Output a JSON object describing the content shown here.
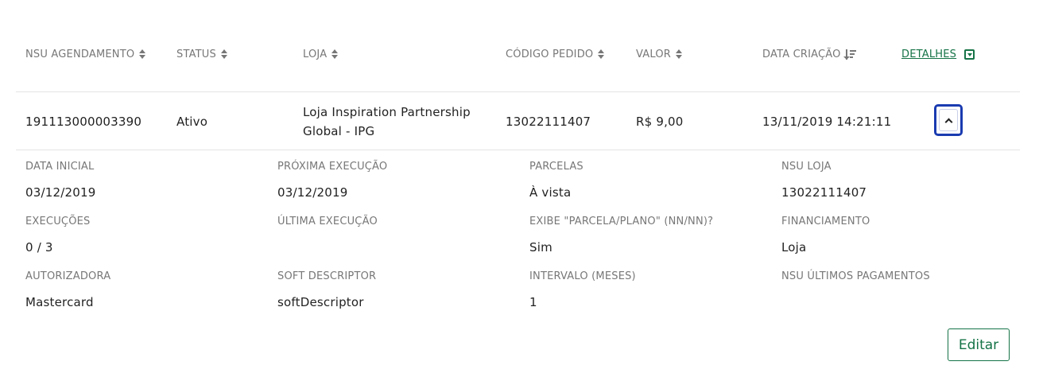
{
  "table": {
    "headers": [
      {
        "label": "NSU AGENDAMENTO"
      },
      {
        "label": "STATUS"
      },
      {
        "label": "LOJA"
      },
      {
        "label": "CÓDIGO PEDIDO"
      },
      {
        "label": "VALOR"
      },
      {
        "label": "DATA CRIAÇÃO"
      },
      {
        "label": "DETALHES"
      }
    ],
    "row": {
      "nsu": "191113000003390",
      "status": "Ativo",
      "loja_line1": "Loja Inspiration Partnership",
      "loja_line2": "Global - IPG",
      "codigo_pedido": "13022111407",
      "valor": "R$ 9,00",
      "data_criacao": "13/11/2019 14:21:11"
    }
  },
  "details": [
    {
      "label": "DATA INICIAL",
      "value": "03/12/2019"
    },
    {
      "label": "PRÓXIMA EXECUÇÃO",
      "value": "03/12/2019"
    },
    {
      "label": "PARCELAS",
      "value": "À vista"
    },
    {
      "label": "NSU LOJA",
      "value": "13022111407"
    },
    {
      "label": "EXECUÇÕES",
      "value": "0 / 3"
    },
    {
      "label": "ÚLTIMA EXECUÇÃO",
      "value": ""
    },
    {
      "label": "EXIBE \"PARCELA/PLANO\" (NN/NN)?",
      "value": "Sim"
    },
    {
      "label": "FINANCIAMENTO",
      "value": "Loja"
    },
    {
      "label": "AUTORIZADORA",
      "value": "Mastercard"
    },
    {
      "label": "SOFT DESCRIPTOR",
      "value": "softDescriptor"
    },
    {
      "label": "INTERVALO (MESES)",
      "value": "1"
    },
    {
      "label": "NSU ÚLTIMOS PAGAMENTOS",
      "value": ""
    }
  ],
  "actions": {
    "edit_label": "Editar"
  },
  "colors": {
    "accent": "#157347",
    "focus": "#1a3bb0"
  }
}
